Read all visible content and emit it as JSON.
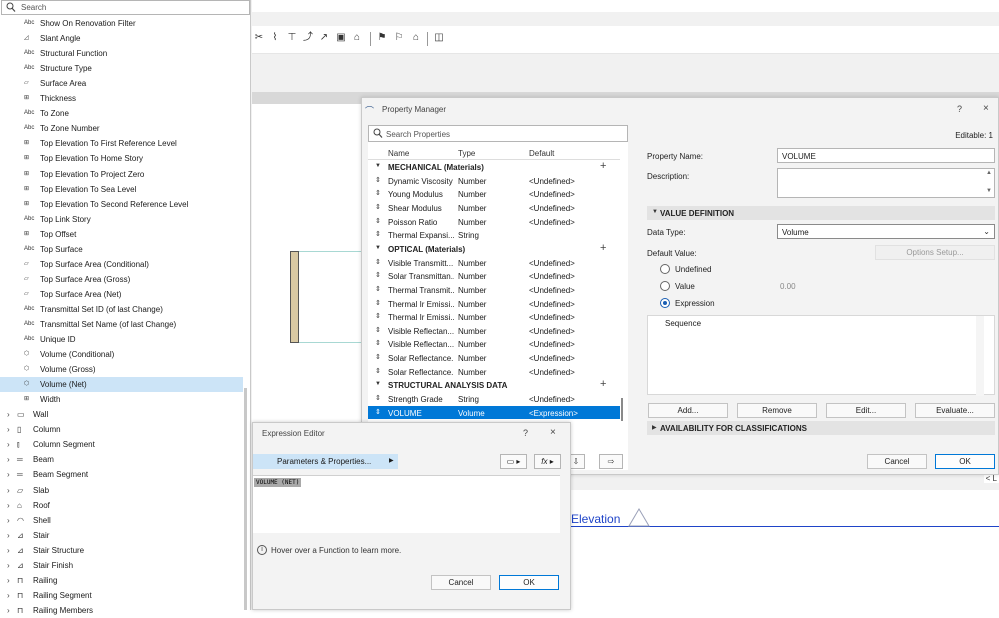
{
  "left_panel": {
    "search_placeholder": "Search",
    "properties": [
      {
        "icon": "Abc",
        "label": "Show On Renovation Filter"
      },
      {
        "icon": "triangle",
        "label": "Slant Angle"
      },
      {
        "icon": "Abc",
        "label": "Structural Function"
      },
      {
        "icon": "Abc",
        "label": "Structure Type"
      },
      {
        "icon": "area",
        "label": "Surface Area"
      },
      {
        "icon": "length",
        "label": "Thickness"
      },
      {
        "icon": "Abc",
        "label": "To Zone"
      },
      {
        "icon": "Abc",
        "label": "To Zone Number"
      },
      {
        "icon": "length",
        "label": "Top Elevation To First Reference Level"
      },
      {
        "icon": "length",
        "label": "Top Elevation To Home Story"
      },
      {
        "icon": "length",
        "label": "Top Elevation To Project Zero"
      },
      {
        "icon": "length",
        "label": "Top Elevation To Sea Level"
      },
      {
        "icon": "length",
        "label": "Top Elevation To Second Reference Level"
      },
      {
        "icon": "Abc",
        "label": "Top Link Story"
      },
      {
        "icon": "length",
        "label": "Top Offset"
      },
      {
        "icon": "Abc",
        "label": "Top Surface"
      },
      {
        "icon": "area",
        "label": "Top Surface Area (Conditional)"
      },
      {
        "icon": "area",
        "label": "Top Surface Area (Gross)"
      },
      {
        "icon": "area",
        "label": "Top Surface Area (Net)"
      },
      {
        "icon": "Abc",
        "label": "Transmittal Set ID (of last Change)"
      },
      {
        "icon": "Abc",
        "label": "Transmittal Set Name (of last Change)"
      },
      {
        "icon": "Abc",
        "label": "Unique ID"
      },
      {
        "icon": "volume",
        "label": "Volume (Conditional)"
      },
      {
        "icon": "volume",
        "label": "Volume (Gross)"
      },
      {
        "icon": "volume",
        "label": "Volume (Net)"
      },
      {
        "icon": "length",
        "label": "Width"
      }
    ],
    "selected_property": "Volume (Net)",
    "categories": [
      {
        "icon": "wall-icon",
        "label": "Wall"
      },
      {
        "icon": "column-icon",
        "label": "Column"
      },
      {
        "icon": "column-segment-icon",
        "label": "Column Segment"
      },
      {
        "icon": "beam-icon",
        "label": "Beam"
      },
      {
        "icon": "beam-segment-icon",
        "label": "Beam Segment"
      },
      {
        "icon": "slab-icon",
        "label": "Slab"
      },
      {
        "icon": "roof-icon",
        "label": "Roof"
      },
      {
        "icon": "shell-icon",
        "label": "Shell"
      },
      {
        "icon": "stair-icon",
        "label": "Stair"
      },
      {
        "icon": "stair-structure-icon",
        "label": "Stair Structure"
      },
      {
        "icon": "stair-finish-icon",
        "label": "Stair Finish"
      },
      {
        "icon": "railing-icon",
        "label": "Railing"
      },
      {
        "icon": "railing-segment-icon",
        "label": "Railing Segment"
      },
      {
        "icon": "railing-members-icon",
        "label": "Railing Members"
      }
    ]
  },
  "property_manager": {
    "title": "Property Manager",
    "help": "?",
    "close": "×",
    "search_placeholder": "Search Properties",
    "columns": {
      "name": "Name",
      "type": "Type",
      "default": "Default"
    },
    "groups": [
      {
        "name": "MECHANICAL (Materials)",
        "rows": [
          {
            "name": "Dynamic Viscosity",
            "type": "Number",
            "default": "<Undefined>"
          },
          {
            "name": "Young Modulus",
            "type": "Number",
            "default": "<Undefined>"
          },
          {
            "name": "Shear Modulus",
            "type": "Number",
            "default": "<Undefined>"
          },
          {
            "name": "Poisson Ratio",
            "type": "Number",
            "default": "<Undefined>"
          },
          {
            "name": "Thermal Expansi...",
            "type": "String",
            "default": ""
          }
        ]
      },
      {
        "name": "OPTICAL (Materials)",
        "rows": [
          {
            "name": "Visible Transmitt...",
            "type": "Number",
            "default": "<Undefined>"
          },
          {
            "name": "Solar Transmittan...",
            "type": "Number",
            "default": "<Undefined>"
          },
          {
            "name": "Thermal Transmit...",
            "type": "Number",
            "default": "<Undefined>"
          },
          {
            "name": "Thermal Ir Emissi...",
            "type": "Number",
            "default": "<Undefined>"
          },
          {
            "name": "Thermal Ir Emissi...",
            "type": "Number",
            "default": "<Undefined>"
          },
          {
            "name": "Visible Reflectan...",
            "type": "Number",
            "default": "<Undefined>"
          },
          {
            "name": "Visible Reflectan...",
            "type": "Number",
            "default": "<Undefined>"
          },
          {
            "name": "Solar Reflectance...",
            "type": "Number",
            "default": "<Undefined>"
          },
          {
            "name": "Solar Reflectance...",
            "type": "Number",
            "default": "<Undefined>"
          }
        ]
      },
      {
        "name": "STRUCTURAL ANALYSIS DATA",
        "rows": [
          {
            "name": "Strength Grade",
            "type": "String",
            "default": "<Undefined>"
          },
          {
            "name": "VOLUME",
            "type": "Volume",
            "default": "<Expression>"
          }
        ]
      }
    ],
    "editable_label": "Editable: 1",
    "property_name_label": "Property Name:",
    "property_name_value": "VOLUME",
    "description_label": "Description:",
    "description_value": "",
    "value_definition_label": "VALUE DEFINITION",
    "data_type_label": "Data Type:",
    "data_type_value": "Volume",
    "default_value_label": "Default Value:",
    "options_setup_label": "Options Setup...",
    "radio_undefined": "Undefined",
    "radio_value": "Value",
    "value_number": "0.00",
    "radio_expression": "Expression",
    "selected_radio": "Expression",
    "expression_text": "Sequence",
    "add_label": "Add...",
    "remove_label": "Remove",
    "edit_label": "Edit...",
    "evaluate_label": "Evaluate...",
    "availability_label": "AVAILABILITY FOR CLASSIFICATIONS",
    "cancel_label": "Cancel",
    "ok_label": "OK"
  },
  "expression_editor": {
    "title": "Expression Editor",
    "help": "?",
    "close": "×",
    "params_label": "Parameters & Properties...",
    "fx_label": "fx",
    "expression_token": "VOLUME (NET)",
    "info_text": "Hover over a Function to learn more.",
    "cancel_label": "Cancel",
    "ok_label": "OK"
  },
  "background": {
    "elevation_label": "Elevation",
    "edge_label": "< L"
  },
  "colors": {
    "selection_blue": "#0078d7",
    "selection_light": "#cce4f7",
    "elevation_blue": "#1f44c8"
  }
}
